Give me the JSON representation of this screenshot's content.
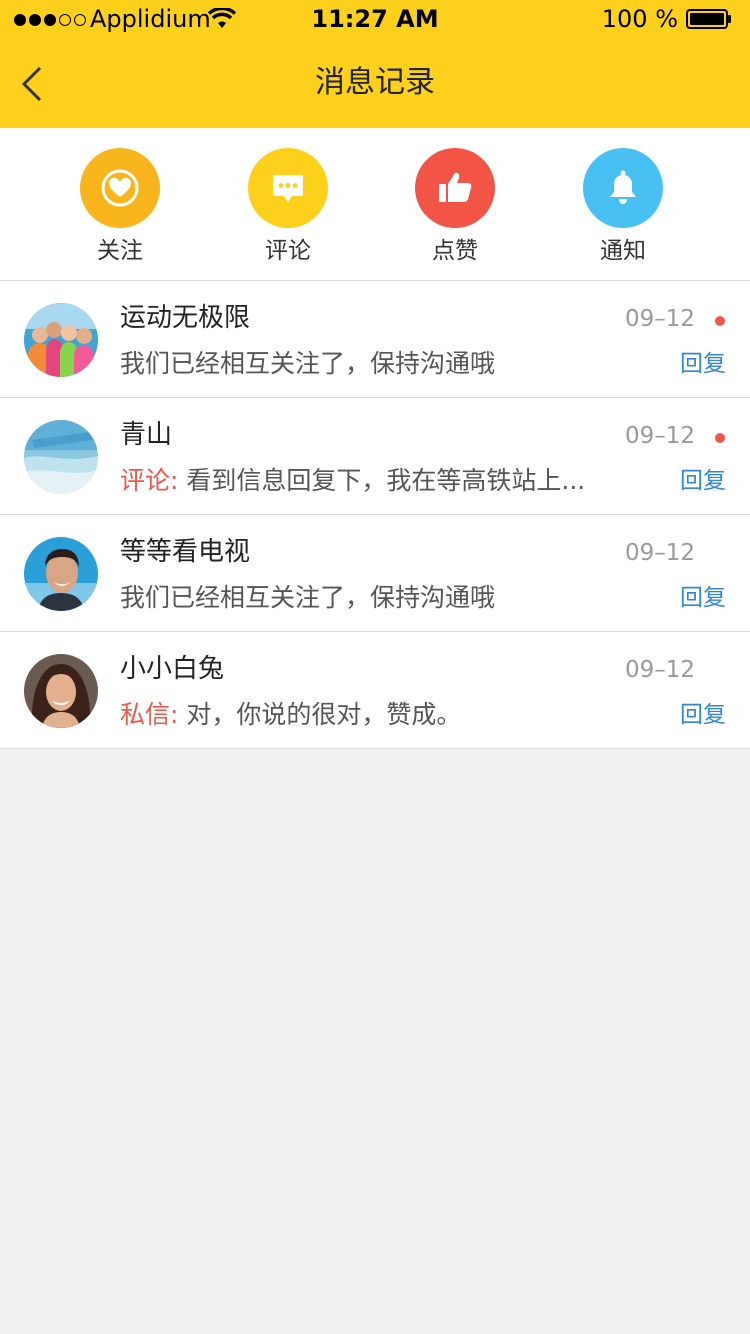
{
  "status_bar": {
    "carrier": "Applidium",
    "time": "11:27 AM",
    "battery": "100 %"
  },
  "nav": {
    "title": "消息记录",
    "back_icon": "chevron-left-icon"
  },
  "categories": [
    {
      "label": "关注",
      "color": "#f9b51c",
      "icon": "heart-icon"
    },
    {
      "label": "评论",
      "color": "#fdd11b",
      "icon": "comment-icon"
    },
    {
      "label": "点赞",
      "color": "#f25445",
      "icon": "thumbs-up-icon"
    },
    {
      "label": "通知",
      "color": "#49c0f4",
      "icon": "bell-icon"
    }
  ],
  "messages": [
    {
      "name": "运动无极限",
      "prefix": "",
      "text": "我们已经相互关注了，保持沟通哦",
      "date": "09–12",
      "unread": true,
      "reply": "回复"
    },
    {
      "name": "青山",
      "prefix": "评论:",
      "text": " 看到信息回复下，我在等高铁站上...",
      "date": "09–12",
      "unread": true,
      "reply": "回复"
    },
    {
      "name": "等等看电视",
      "prefix": "",
      "text": "我们已经相互关注了，保持沟通哦",
      "date": "09–12",
      "unread": false,
      "reply": "回复"
    },
    {
      "name": "小小白兔",
      "prefix": "私信:",
      "text": " 对，你说的很对，赞成。",
      "date": "09–12",
      "unread": false,
      "reply": "回复"
    }
  ],
  "colors": {
    "header": "#fdd11b",
    "unread_dot": "#f2564a",
    "reply": "#2f87d8"
  }
}
